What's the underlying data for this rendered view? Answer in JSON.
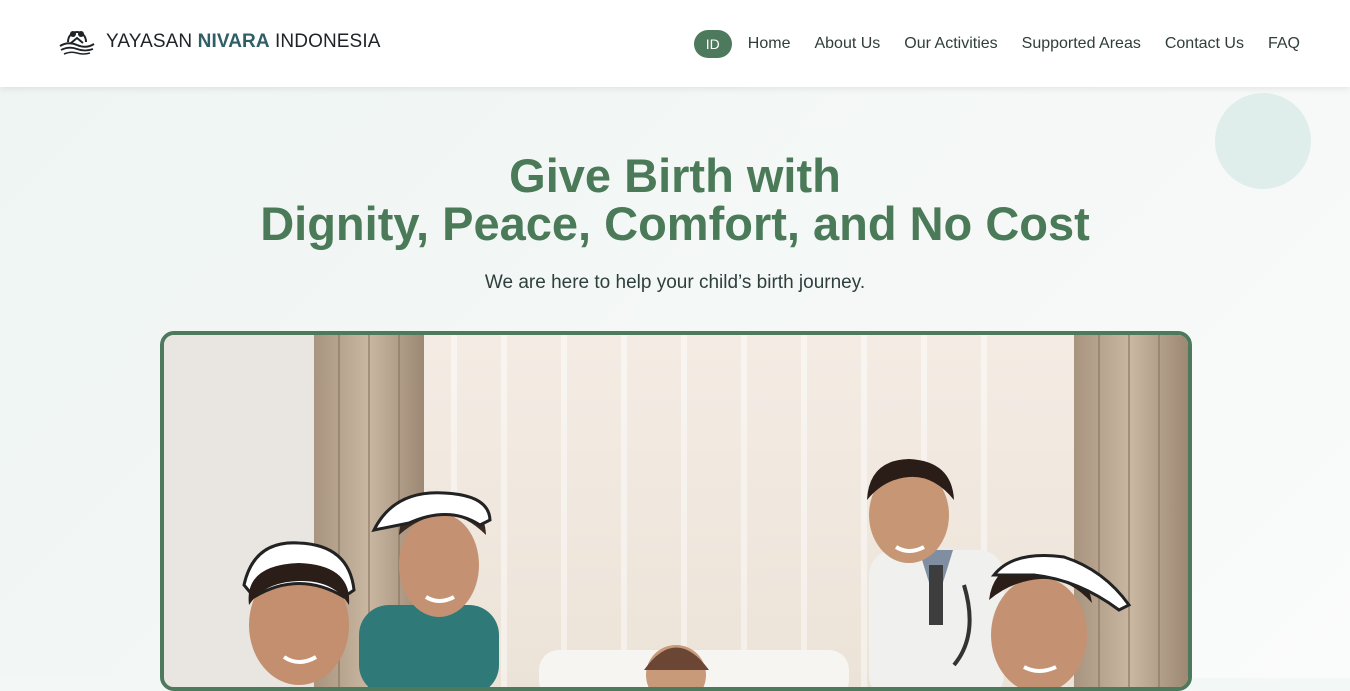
{
  "header": {
    "brand": {
      "prefix": "YAYASAN",
      "accent": "NIVARA",
      "suffix": "INDONESIA",
      "logo_icon": "mother-child-wave-logo"
    },
    "language_toggle": "ID",
    "nav": [
      {
        "label": "Home"
      },
      {
        "label": "About Us"
      },
      {
        "label": "Our Activities"
      },
      {
        "label": "Supported Areas"
      },
      {
        "label": "Contact Us"
      },
      {
        "label": "FAQ"
      }
    ]
  },
  "hero": {
    "title_line1": "Give Birth with",
    "title_line2": "Dignity, Peace, Comfort, and No Cost",
    "subtitle": "We are here to help your child’s birth journey.",
    "image": {
      "depicts": "medical-team-photo",
      "alt": "Nurses and a doctor smiling beside a mother in a hospital room"
    }
  },
  "colors": {
    "brand_green": "#4d7a5c",
    "title_green": "#4a7a58",
    "accent_teal": "#2f5e66",
    "text_dark": "#2e3f3c"
  }
}
